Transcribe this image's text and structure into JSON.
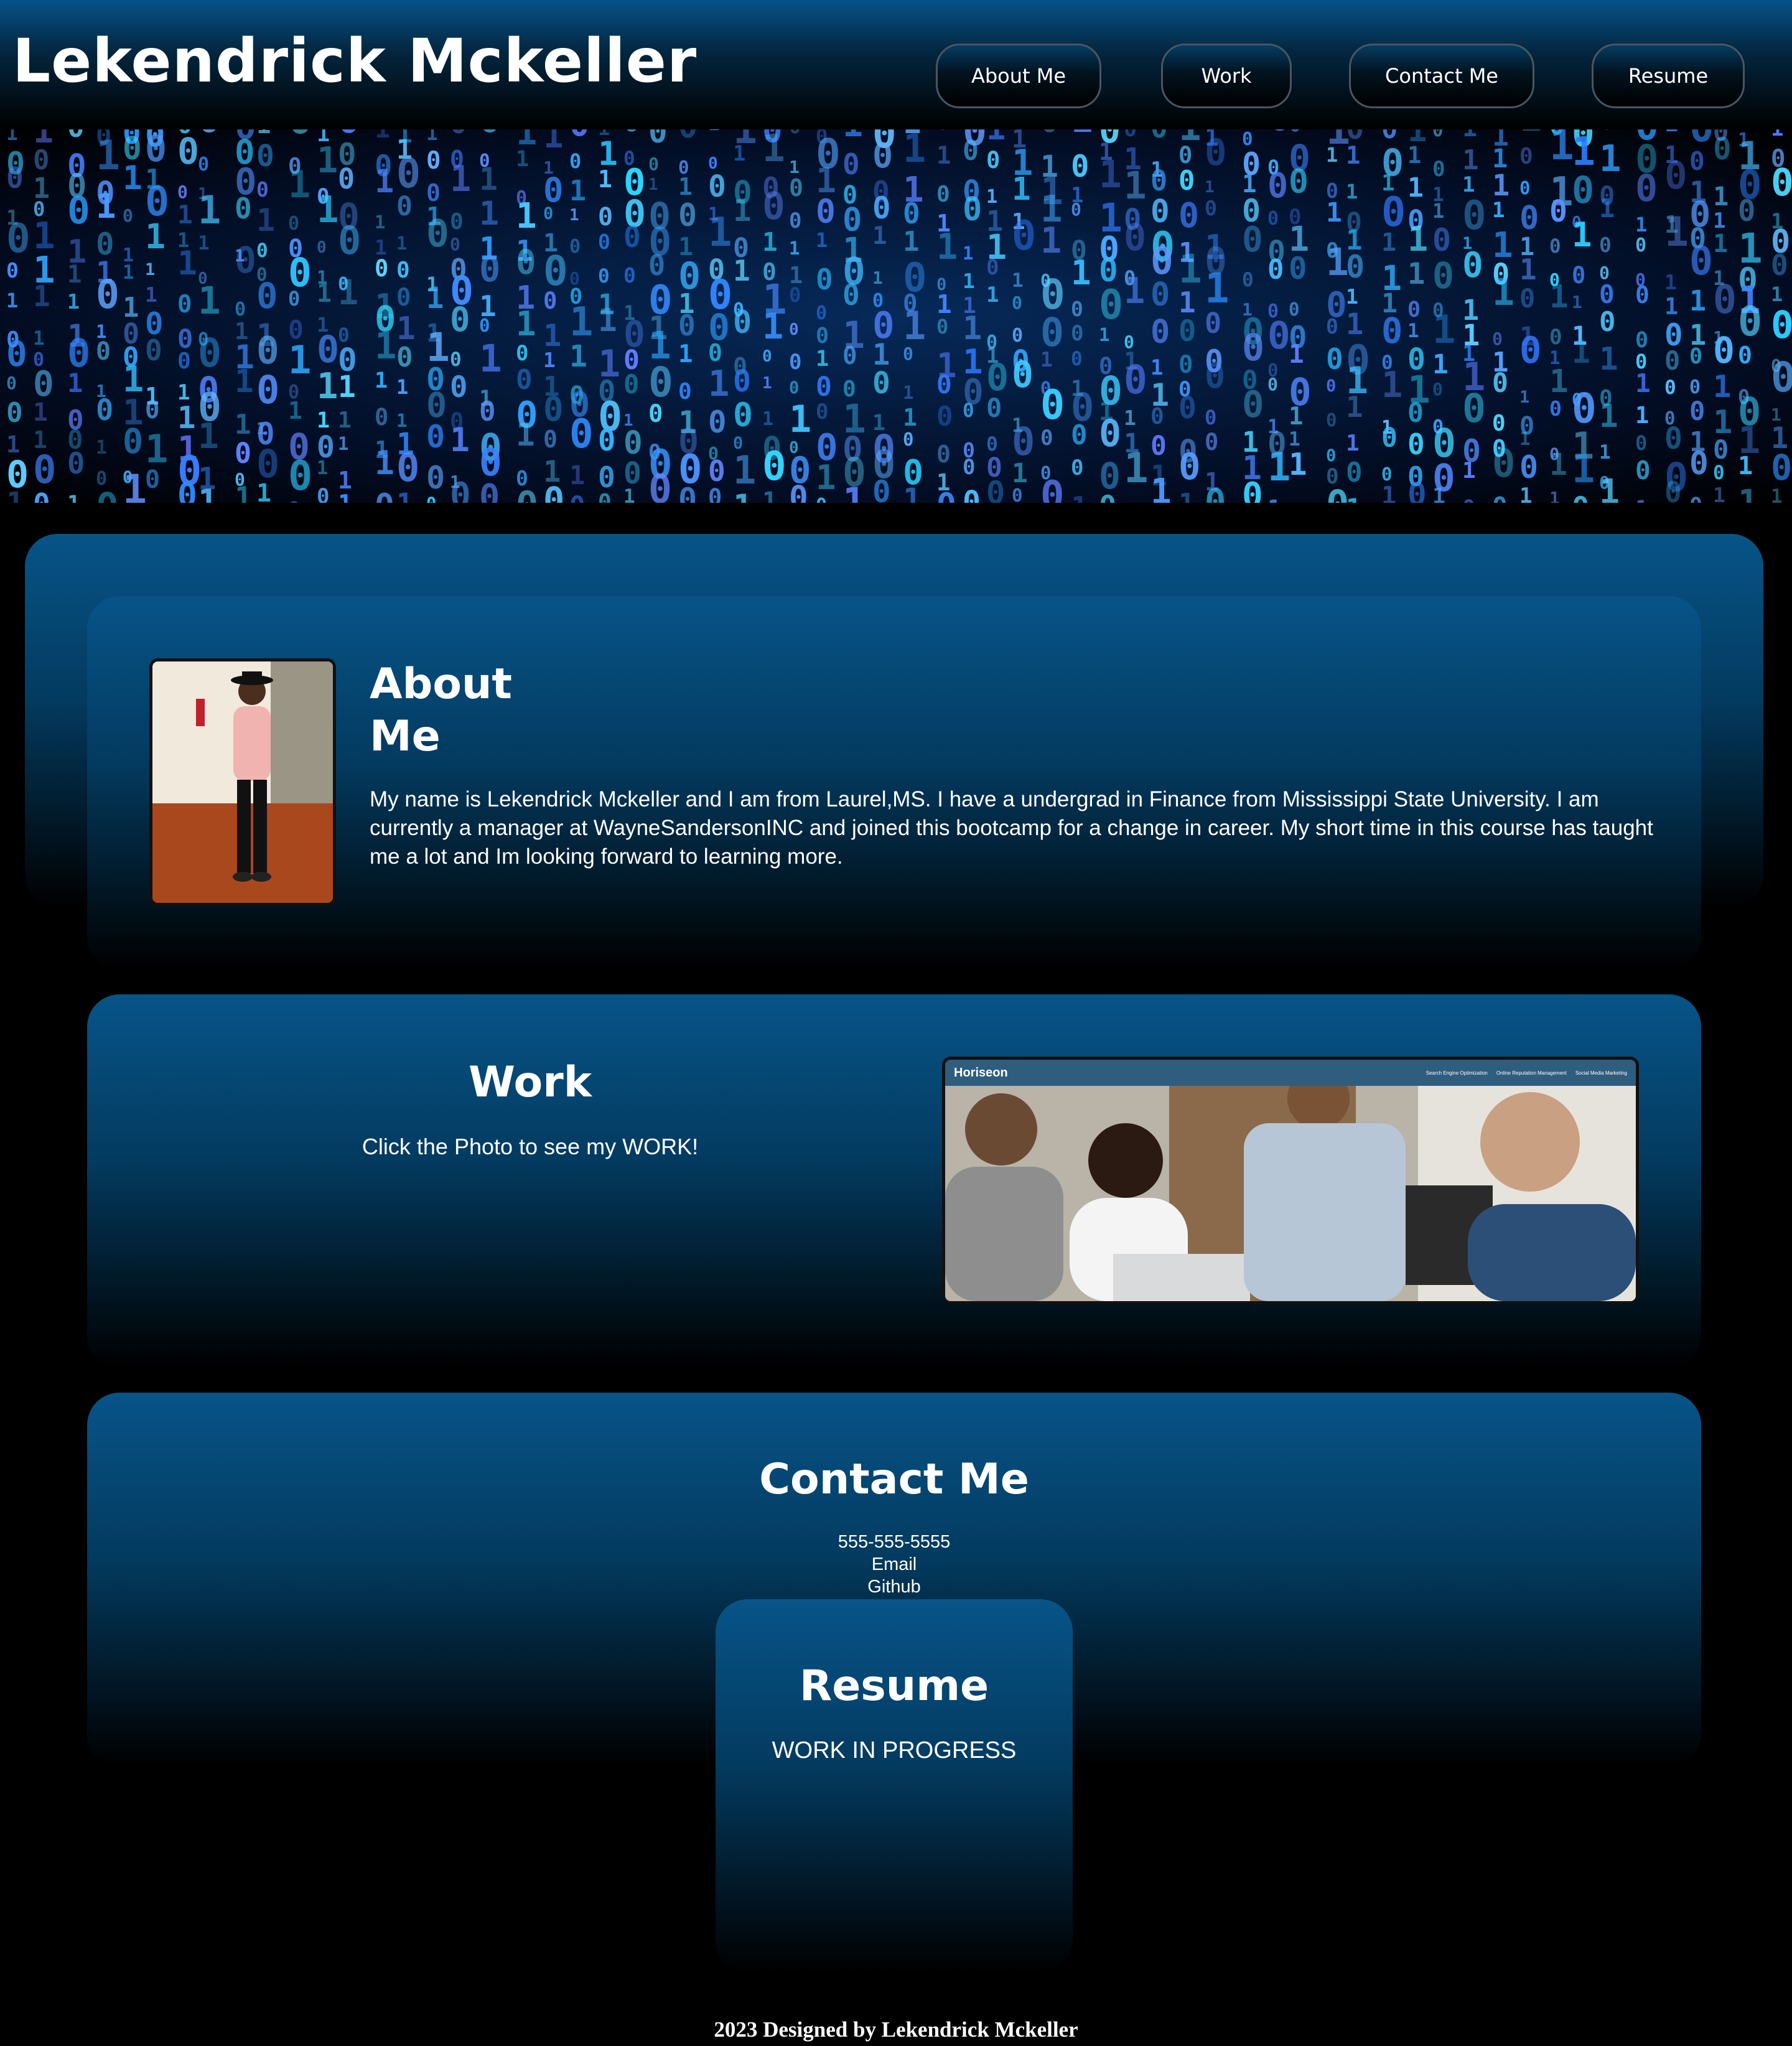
{
  "header": {
    "title": "Lekendrick Mckeller",
    "nav": [
      {
        "label": "About Me"
      },
      {
        "label": "Work"
      },
      {
        "label": "Contact Me"
      },
      {
        "label": "Resume"
      }
    ]
  },
  "about": {
    "title": "About Me",
    "text": "My name is Lekendrick Mckeller and I am from Laurel,MS. I have a undergrad in Finance from Mississippi State University. I am currently a manager at WayneSandersonINC and joined this bootcamp for a change in career. My short time in this course has taught me a lot and Im looking forward to learning more."
  },
  "work": {
    "title": "Work",
    "subtitle": "Click the Photo to see my WORK!",
    "thumbnail": {
      "brand": "Horiseon",
      "links": [
        "Search Engine Optimization",
        "Online Reputation Management",
        "Social Media Marketing"
      ]
    }
  },
  "contact": {
    "title": "Contact Me",
    "phone": "555-555-5555",
    "email": "Email",
    "github": "Github"
  },
  "resume": {
    "title": "Resume",
    "status": "WORK IN PROGRESS"
  },
  "footer": {
    "text": "2023 Designed by Lekendrick Mckeller"
  },
  "colors": {
    "accent_blue": "#075488",
    "background": "#000000",
    "text": "#ffffff"
  }
}
